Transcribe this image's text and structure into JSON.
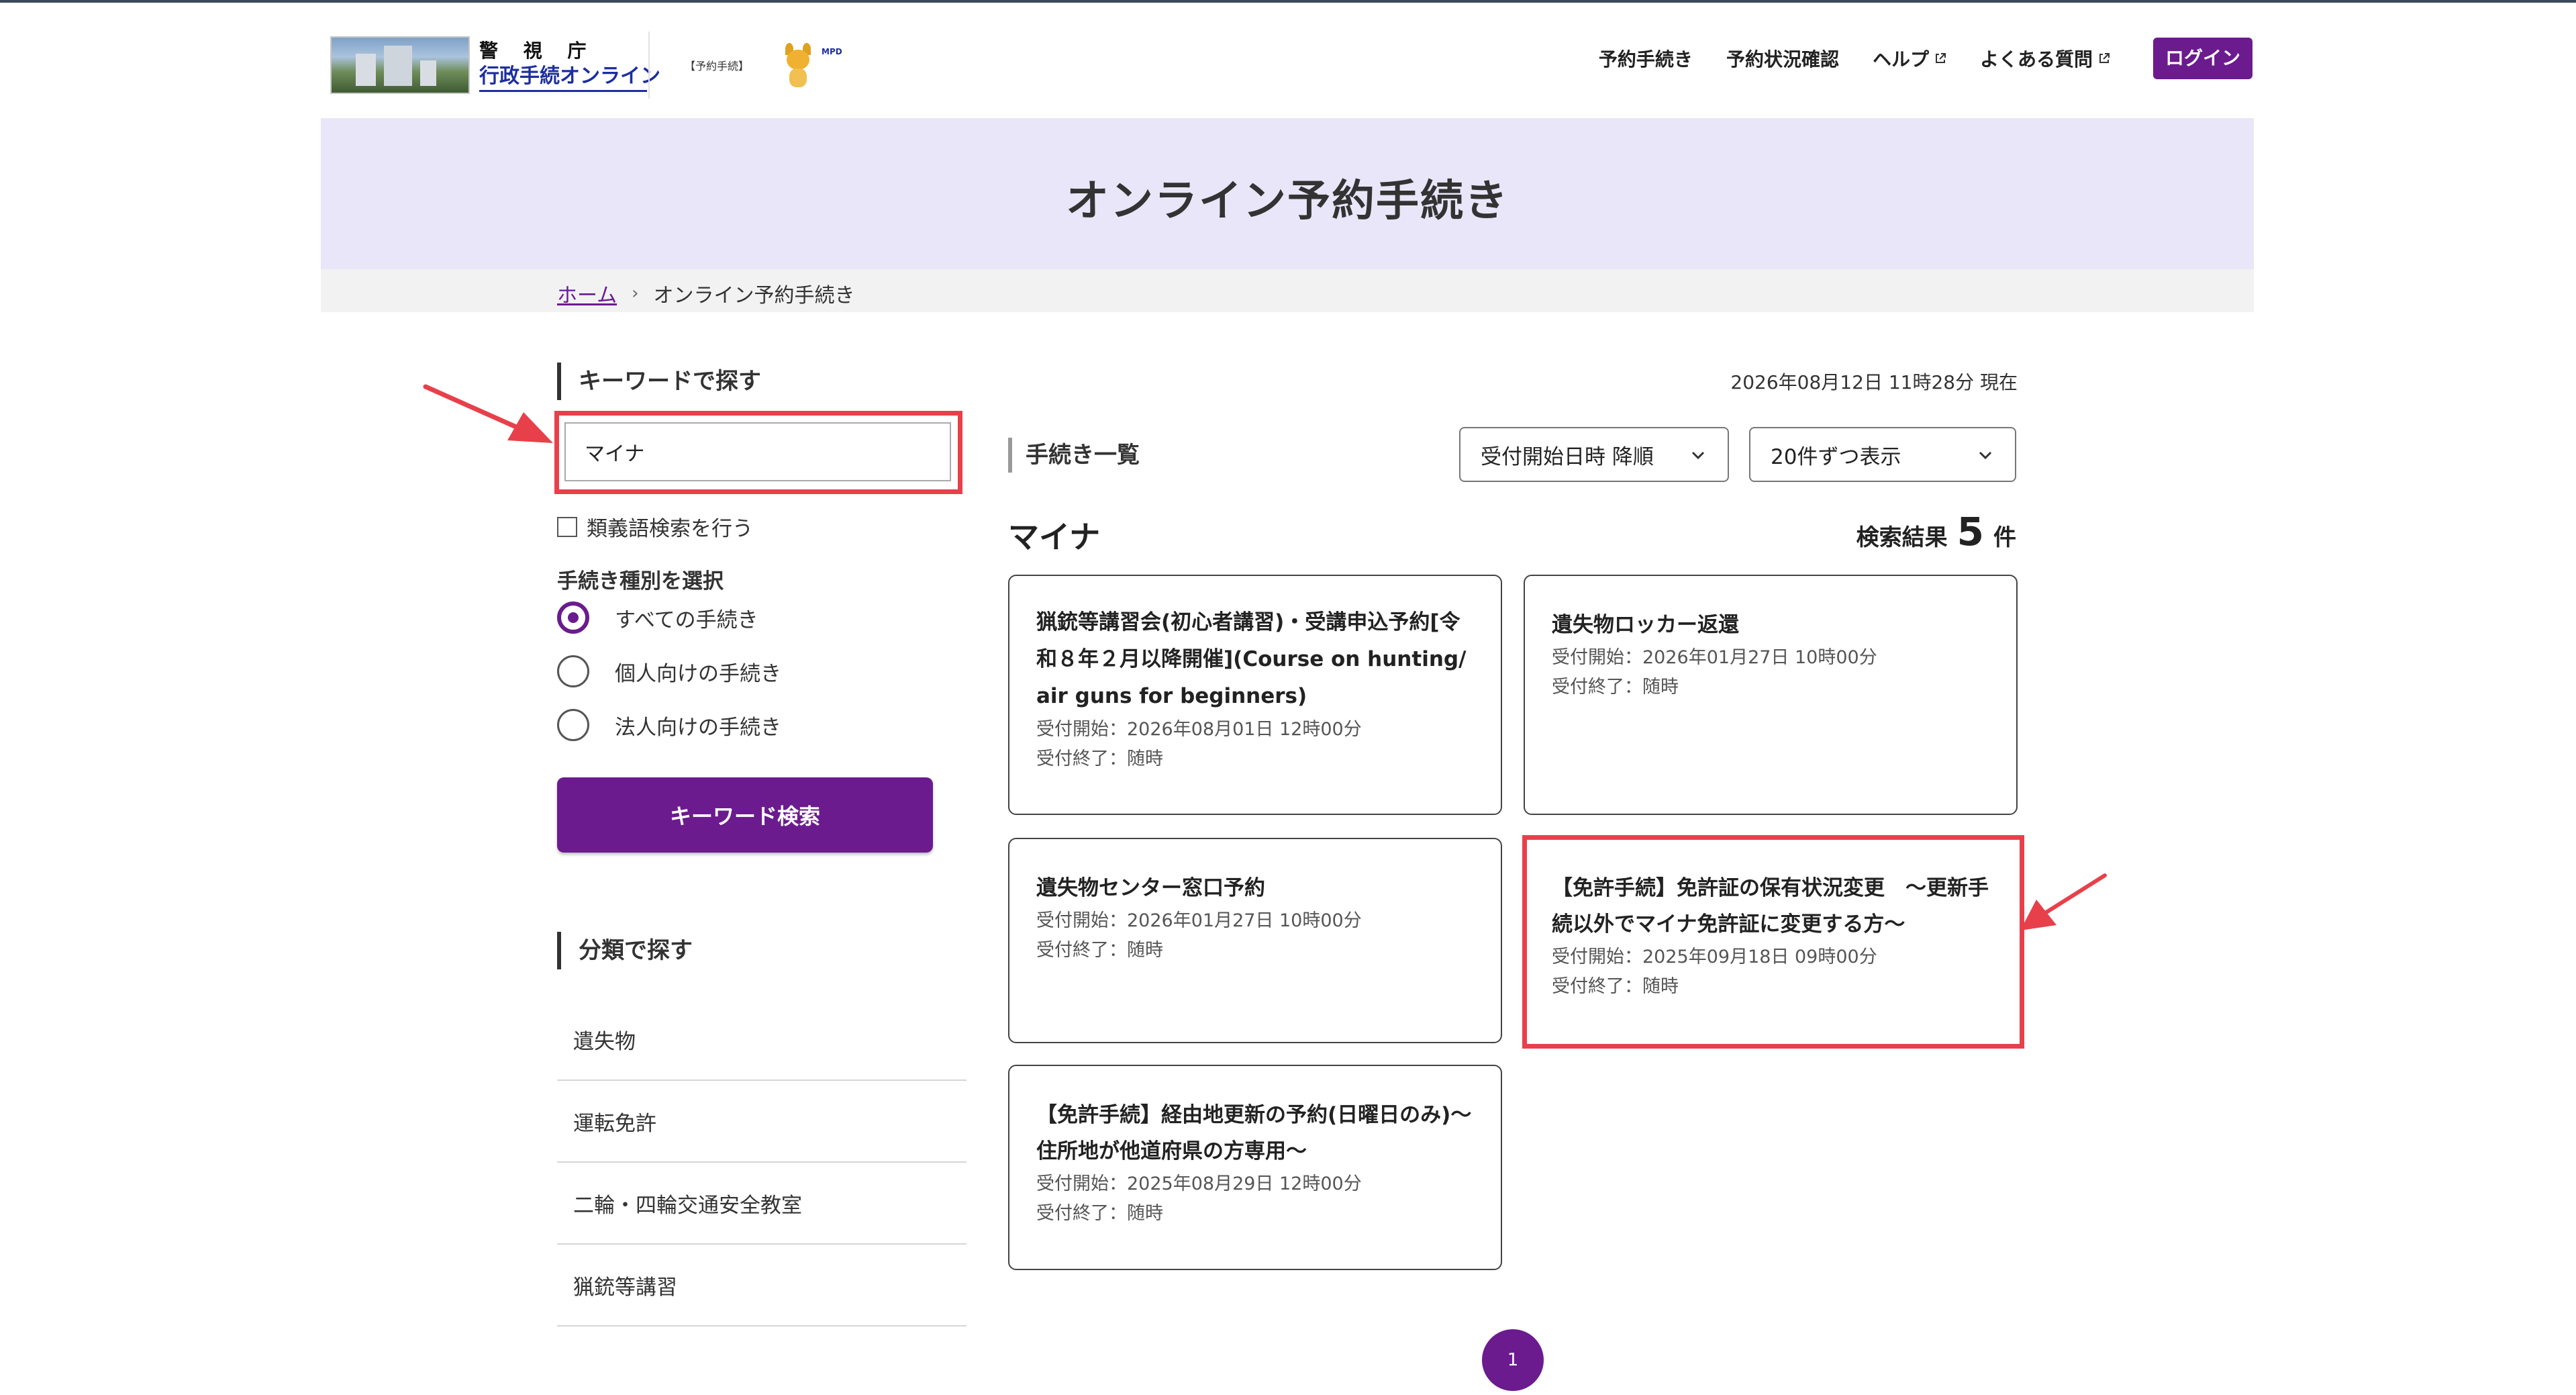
{
  "header": {
    "logo_line1": "警 視 庁",
    "logo_line2": "行政手続オンライン",
    "logo_tag": "【予約手続】",
    "mpd_mark": "MPD",
    "nav": [
      {
        "label": "予約手続き"
      },
      {
        "label": "予約状況確認"
      },
      {
        "label": "ヘルプ"
      },
      {
        "label": "よくある質問"
      }
    ],
    "login_label": "ログイン"
  },
  "banner": {
    "title": "オンライン予約手続き"
  },
  "breadcrumb": {
    "home": "ホーム",
    "sep": "›",
    "current": "オンライン予約手続き"
  },
  "sidebar": {
    "keyword_heading": "キーワードで探す",
    "keyword_value": "マイナ",
    "synonym_label": "類義語検索を行う",
    "type_label": "手続き種別を選択",
    "radios": [
      {
        "label": "すべての手続き",
        "selected": true
      },
      {
        "label": "個人向けの手続き",
        "selected": false
      },
      {
        "label": "法人向けの手続き",
        "selected": false
      }
    ],
    "search_button": "キーワード検索",
    "category_heading": "分類で探す",
    "categories": [
      "遺失物",
      "運転免許",
      "二輪・四輪交通安全教室",
      "猟銃等講習"
    ]
  },
  "main": {
    "timestamp": "2026年08月12日 11時28分 現在",
    "list_heading": "手続き一覧",
    "sort_select": "受付開始日時 降順",
    "per_page_select": "20件ずつ表示",
    "keyword_title": "マイナ",
    "result_prefix": "検索結果",
    "result_count": "5",
    "result_suffix": "件",
    "cards": [
      {
        "title": "猟銃等講習会(初心者講習)・受講申込予約[令和８年２月以降開催](Course on hunting/air guns for beginners)",
        "start": "受付開始：2026年08月01日 12時00分",
        "end": "受付終了：随時"
      },
      {
        "title": "遺失物ロッカー返還",
        "start": "受付開始：2026年01月27日 10時00分",
        "end": "受付終了：随時"
      },
      {
        "title": "遺失物センター窓口予約",
        "start": "受付開始：2026年01月27日 10時00分",
        "end": "受付終了：随時"
      },
      {
        "title": "【免許手続】免許証の保有状況変更　〜更新手続以外でマイナ免許証に変更する方〜",
        "start": "受付開始：2025年09月18日 09時00分",
        "end": "受付終了：随時"
      },
      {
        "title": "【免許手続】経由地更新の予約(日曜日のみ)〜住所地が他道府県の方専用〜",
        "start": "受付開始：2025年08月29日 12時00分",
        "end": "受付終了：随時"
      }
    ],
    "page": "1"
  },
  "colors": {
    "accent": "#6b1b8e",
    "banner": "#e8e6f8",
    "annotation": "#e8404a"
  }
}
